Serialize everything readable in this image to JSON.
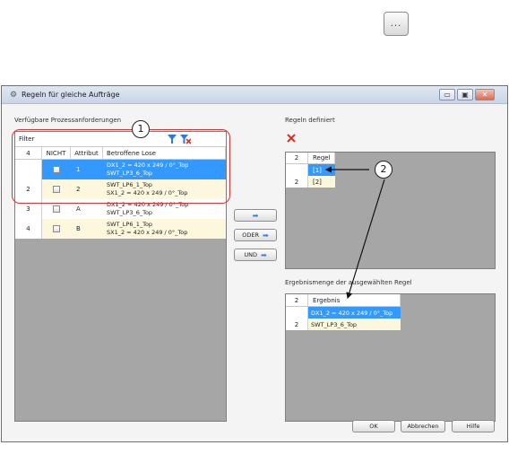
{
  "top_button": {
    "label": "..."
  },
  "window": {
    "title": "Regeln für gleiche Aufträge",
    "controls": {
      "minimize": "▭",
      "maximize": "▣",
      "close": "✕"
    }
  },
  "left": {
    "section_label": "Verfügbare Prozessanforderungen",
    "filter_label": "Filter",
    "columns": {
      "count": "4",
      "nicht": "NICHT",
      "attribut": "Attribut",
      "lose": "Betroffene Lose"
    },
    "rows": [
      {
        "marker": "▸",
        "num": "1",
        "attribut": "1",
        "lose": [
          "DX1_2 = 420 x 249 / 0°_Top",
          "SWT_LP3_6_Top"
        ]
      },
      {
        "marker": "",
        "num": "2",
        "attribut": "2",
        "lose": [
          "SWT_LP6_1_Top",
          "SX1_2 = 420 x 249 / 0°_Top"
        ]
      },
      {
        "marker": "",
        "num": "3",
        "attribut": "A",
        "lose": [
          "DX1_2 = 420 x 249 / 0°_Top",
          "SWT_LP3_6_Top"
        ]
      },
      {
        "marker": "",
        "num": "4",
        "attribut": "B",
        "lose": [
          "SWT_LP6_1_Top",
          "SX1_2 = 420 x 249 / 0°_Top"
        ]
      }
    ]
  },
  "middle_buttons": {
    "add": "",
    "oder": "ODER",
    "und": "UND"
  },
  "rules": {
    "section_label": "Regeln definiert",
    "columns": {
      "count": "2",
      "regel": "Regel"
    },
    "rows": [
      {
        "marker": "▸",
        "num": "1",
        "value": "[1]"
      },
      {
        "marker": "",
        "num": "2",
        "value": "[2]"
      }
    ]
  },
  "result": {
    "section_label": "Ergebnismenge der ausgewählten Regel",
    "columns": {
      "count": "2",
      "ergebnis": "Ergebnis"
    },
    "rows": [
      {
        "marker": "▸",
        "num": "1",
        "value": "DX1_2 = 420 x 249 / 0°_Top"
      },
      {
        "marker": "",
        "num": "2",
        "value": "SWT_LP3_6_Top"
      }
    ]
  },
  "footer": {
    "ok": "OK",
    "cancel": "Abbrechen",
    "help": "Hilfe"
  },
  "callouts": {
    "one": "1",
    "two": "2"
  },
  "colors": {
    "selection": "#3399ff",
    "highlight_row": "#fdf8dd",
    "callout_border": "#e03030",
    "delete": "#d93025",
    "filter": "#2b7bd8"
  }
}
